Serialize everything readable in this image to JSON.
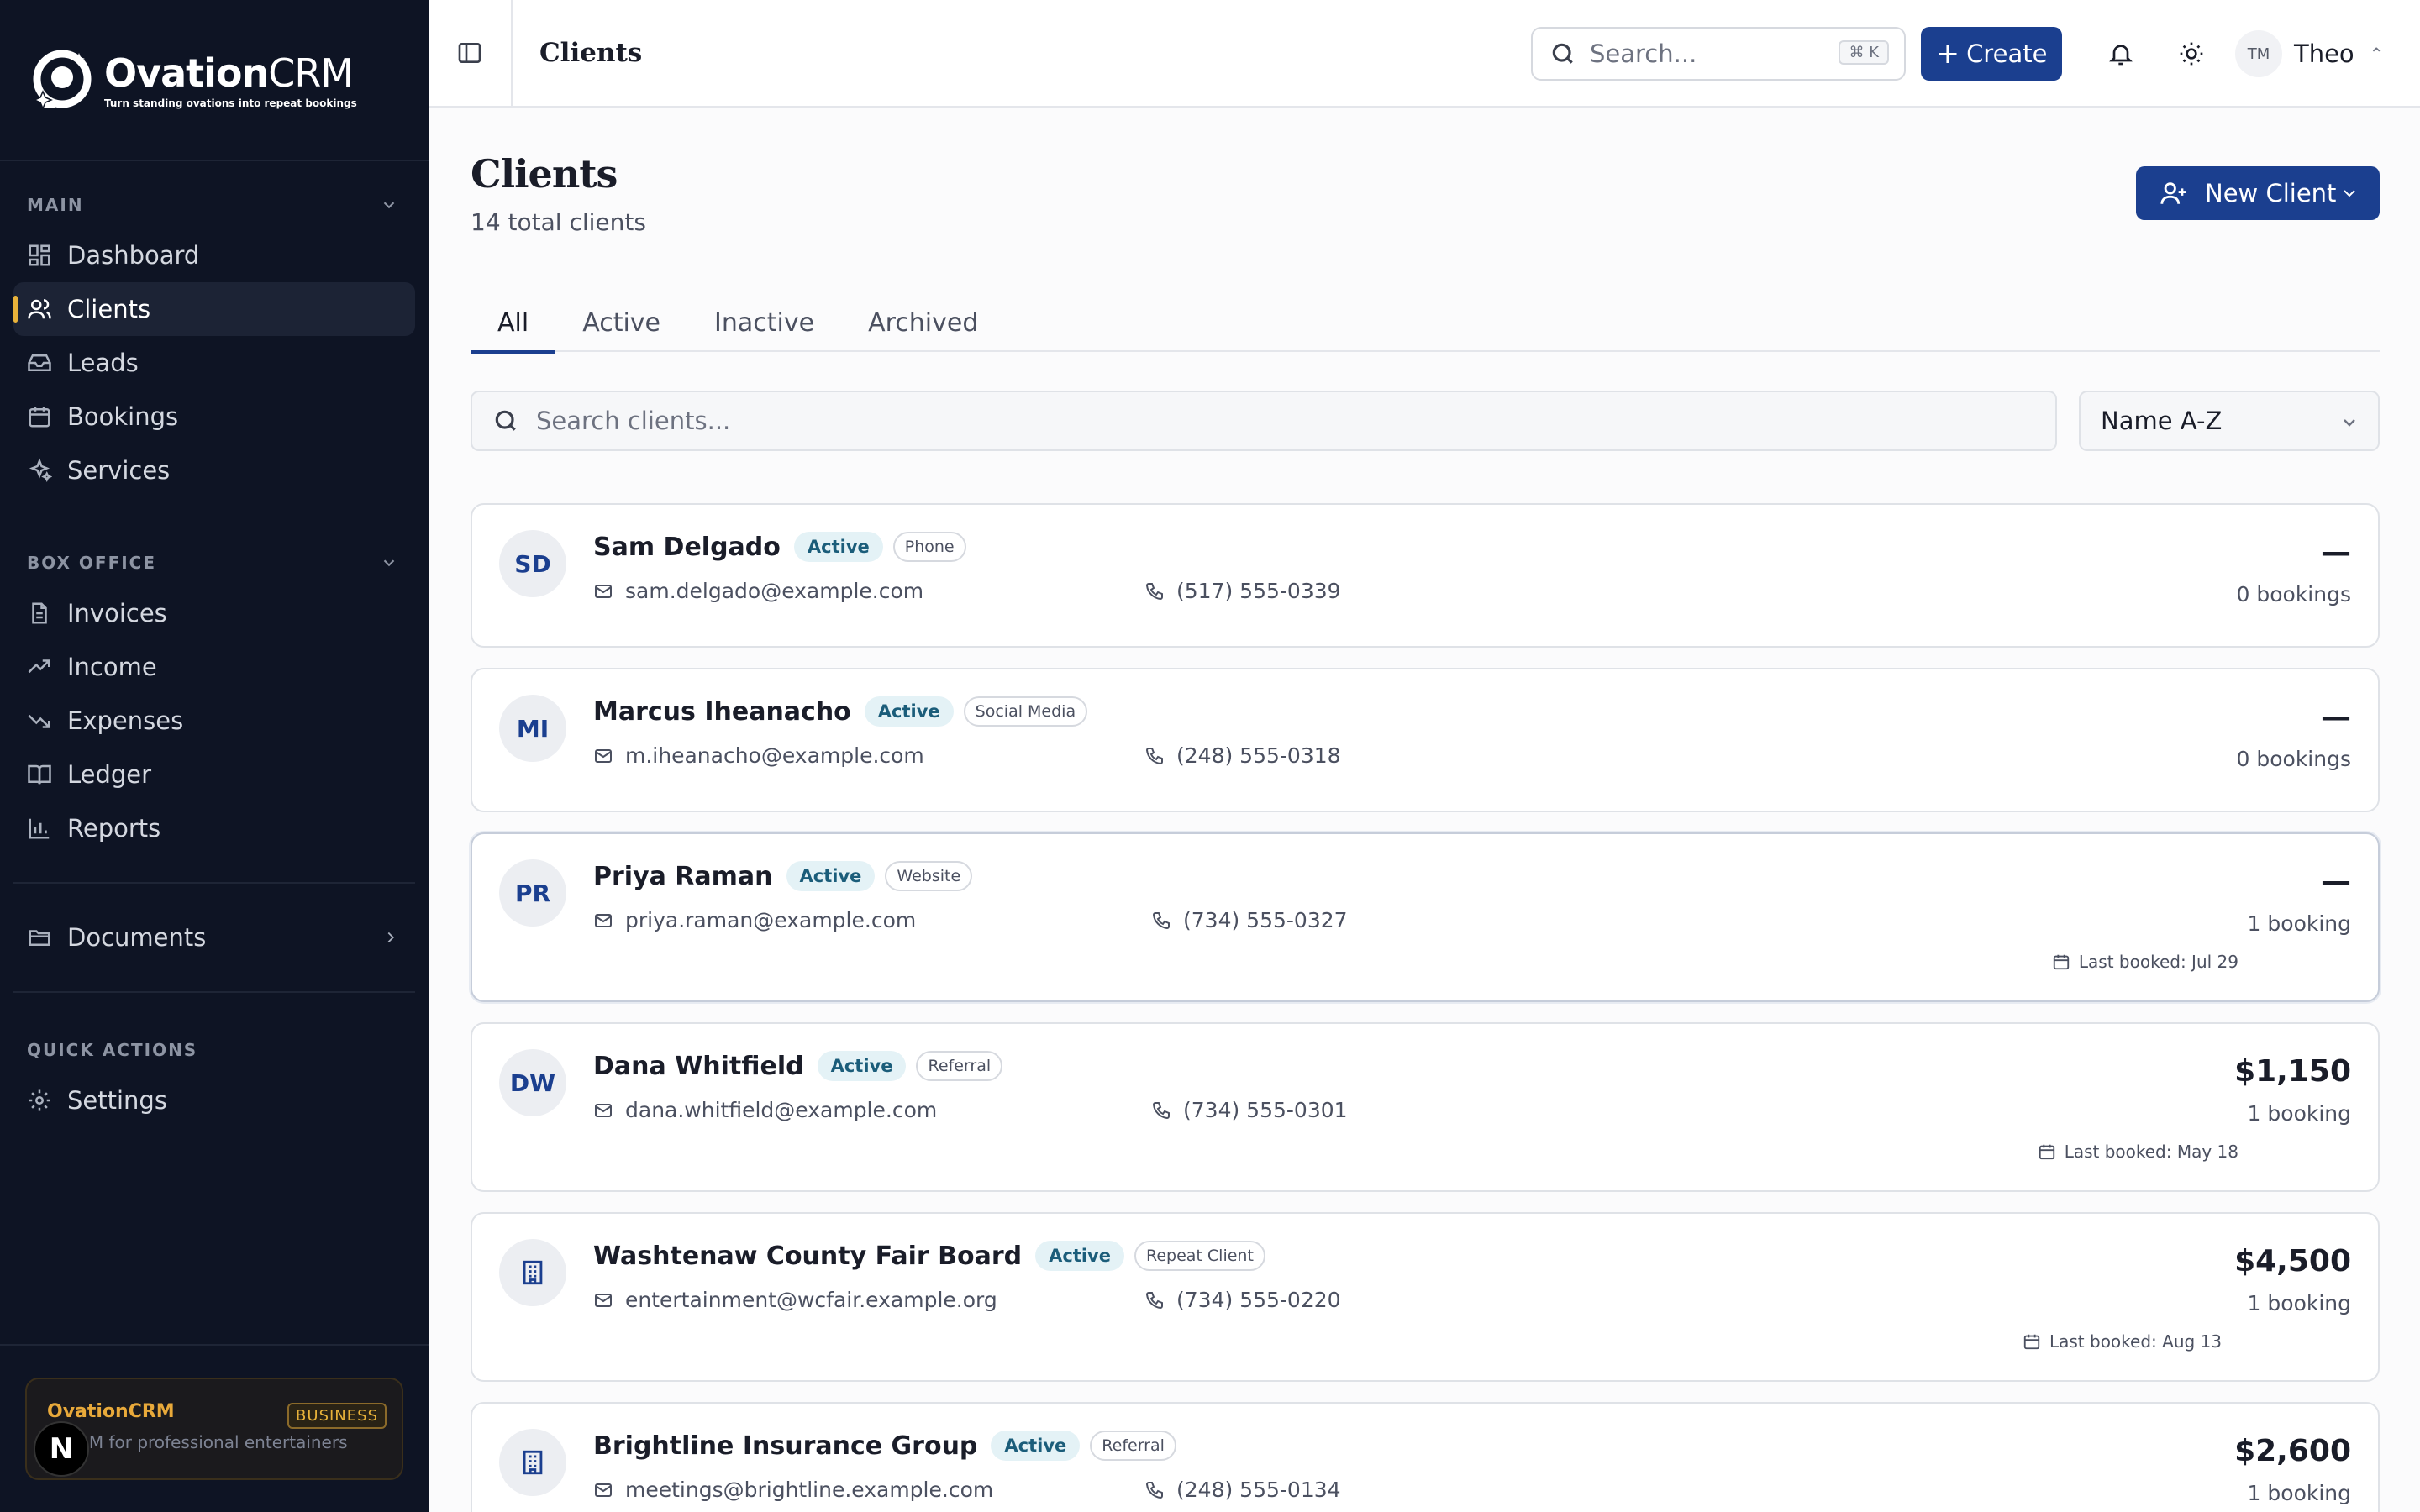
{
  "brand": {
    "name_bold": "Ovation",
    "name_thin": "CRM",
    "tagline": "Turn standing ovations into repeat bookings"
  },
  "sidebar": {
    "sections": [
      {
        "label": "MAIN",
        "items": [
          {
            "label": "Dashboard",
            "icon": "dashboard-icon"
          },
          {
            "label": "Clients",
            "icon": "users-icon",
            "active": true
          },
          {
            "label": "Leads",
            "icon": "inbox-icon"
          },
          {
            "label": "Bookings",
            "icon": "calendar-icon"
          },
          {
            "label": "Services",
            "icon": "sparkles-icon"
          }
        ]
      },
      {
        "label": "BOX OFFICE",
        "items": [
          {
            "label": "Invoices",
            "icon": "file-icon"
          },
          {
            "label": "Income",
            "icon": "trending-up-icon"
          },
          {
            "label": "Expenses",
            "icon": "trending-down-icon"
          },
          {
            "label": "Ledger",
            "icon": "book-icon"
          },
          {
            "label": "Reports",
            "icon": "bar-chart-icon"
          }
        ]
      },
      {
        "label": "",
        "items": [
          {
            "label": "Documents",
            "icon": "folder-icon"
          }
        ]
      },
      {
        "label": "QUICK ACTIONS",
        "items": [
          {
            "label": "Settings",
            "icon": "gear-icon"
          }
        ]
      }
    ],
    "plan": {
      "name": "OvationCRM",
      "badge": "BUSINESS",
      "subtitle": "CRM for professional entertainers"
    },
    "n_badge": "N"
  },
  "topbar": {
    "title": "Clients",
    "search_placeholder": "Search...",
    "shortcut": "⌘ K",
    "create_label": "Create",
    "user_initials": "TM",
    "user_name": "Theo"
  },
  "page": {
    "title": "Clients",
    "subtitle": "14 total clients",
    "new_client_label": "New Client",
    "tabs": [
      "All",
      "Active",
      "Inactive",
      "Archived"
    ],
    "active_tab": "All",
    "search_placeholder": "Search clients...",
    "sort_value": "Name A-Z"
  },
  "clients": [
    {
      "initials": "SD",
      "name": "Sam Delgado",
      "status": "Active",
      "source": "Phone",
      "email": "sam.delgado@example.com",
      "phone": "(517) 555-0339",
      "amount": "—",
      "bookings": "0 bookings",
      "last_booked": ""
    },
    {
      "initials": "MI",
      "name": "Marcus Iheanacho",
      "status": "Active",
      "source": "Social Media",
      "email": "m.iheanacho@example.com",
      "phone": "(248) 555-0318",
      "amount": "—",
      "bookings": "0 bookings",
      "last_booked": ""
    },
    {
      "initials": "PR",
      "name": "Priya Raman",
      "status": "Active",
      "source": "Website",
      "email": "priya.raman@example.com",
      "phone": "(734) 555-0327",
      "amount": "—",
      "bookings": "1 booking",
      "last_booked": "Last booked: Jul 29"
    },
    {
      "initials": "DW",
      "name": "Dana Whitfield",
      "status": "Active",
      "source": "Referral",
      "email": "dana.whitfield@example.com",
      "phone": "(734) 555-0301",
      "amount": "$1,150",
      "bookings": "1 booking",
      "last_booked": "Last booked: May 18"
    },
    {
      "initials": "",
      "org": true,
      "name": "Washtenaw County Fair Board",
      "status": "Active",
      "source": "Repeat Client",
      "email": "entertainment@wcfair.example.org",
      "phone": "(734) 555-0220",
      "amount": "$4,500",
      "bookings": "1 booking",
      "last_booked": "Last booked: Aug 13"
    },
    {
      "initials": "",
      "org": true,
      "name": "Brightline Insurance Group",
      "status": "Active",
      "source": "Referral",
      "email": "meetings@brightline.example.com",
      "phone": "(248) 555-0134",
      "amount": "$2,600",
      "bookings": "1 booking",
      "last_booked": ""
    }
  ],
  "colors": {
    "accent": "#1b3f8f",
    "sidebar": "#0e1424",
    "gold": "#e8b23a"
  }
}
